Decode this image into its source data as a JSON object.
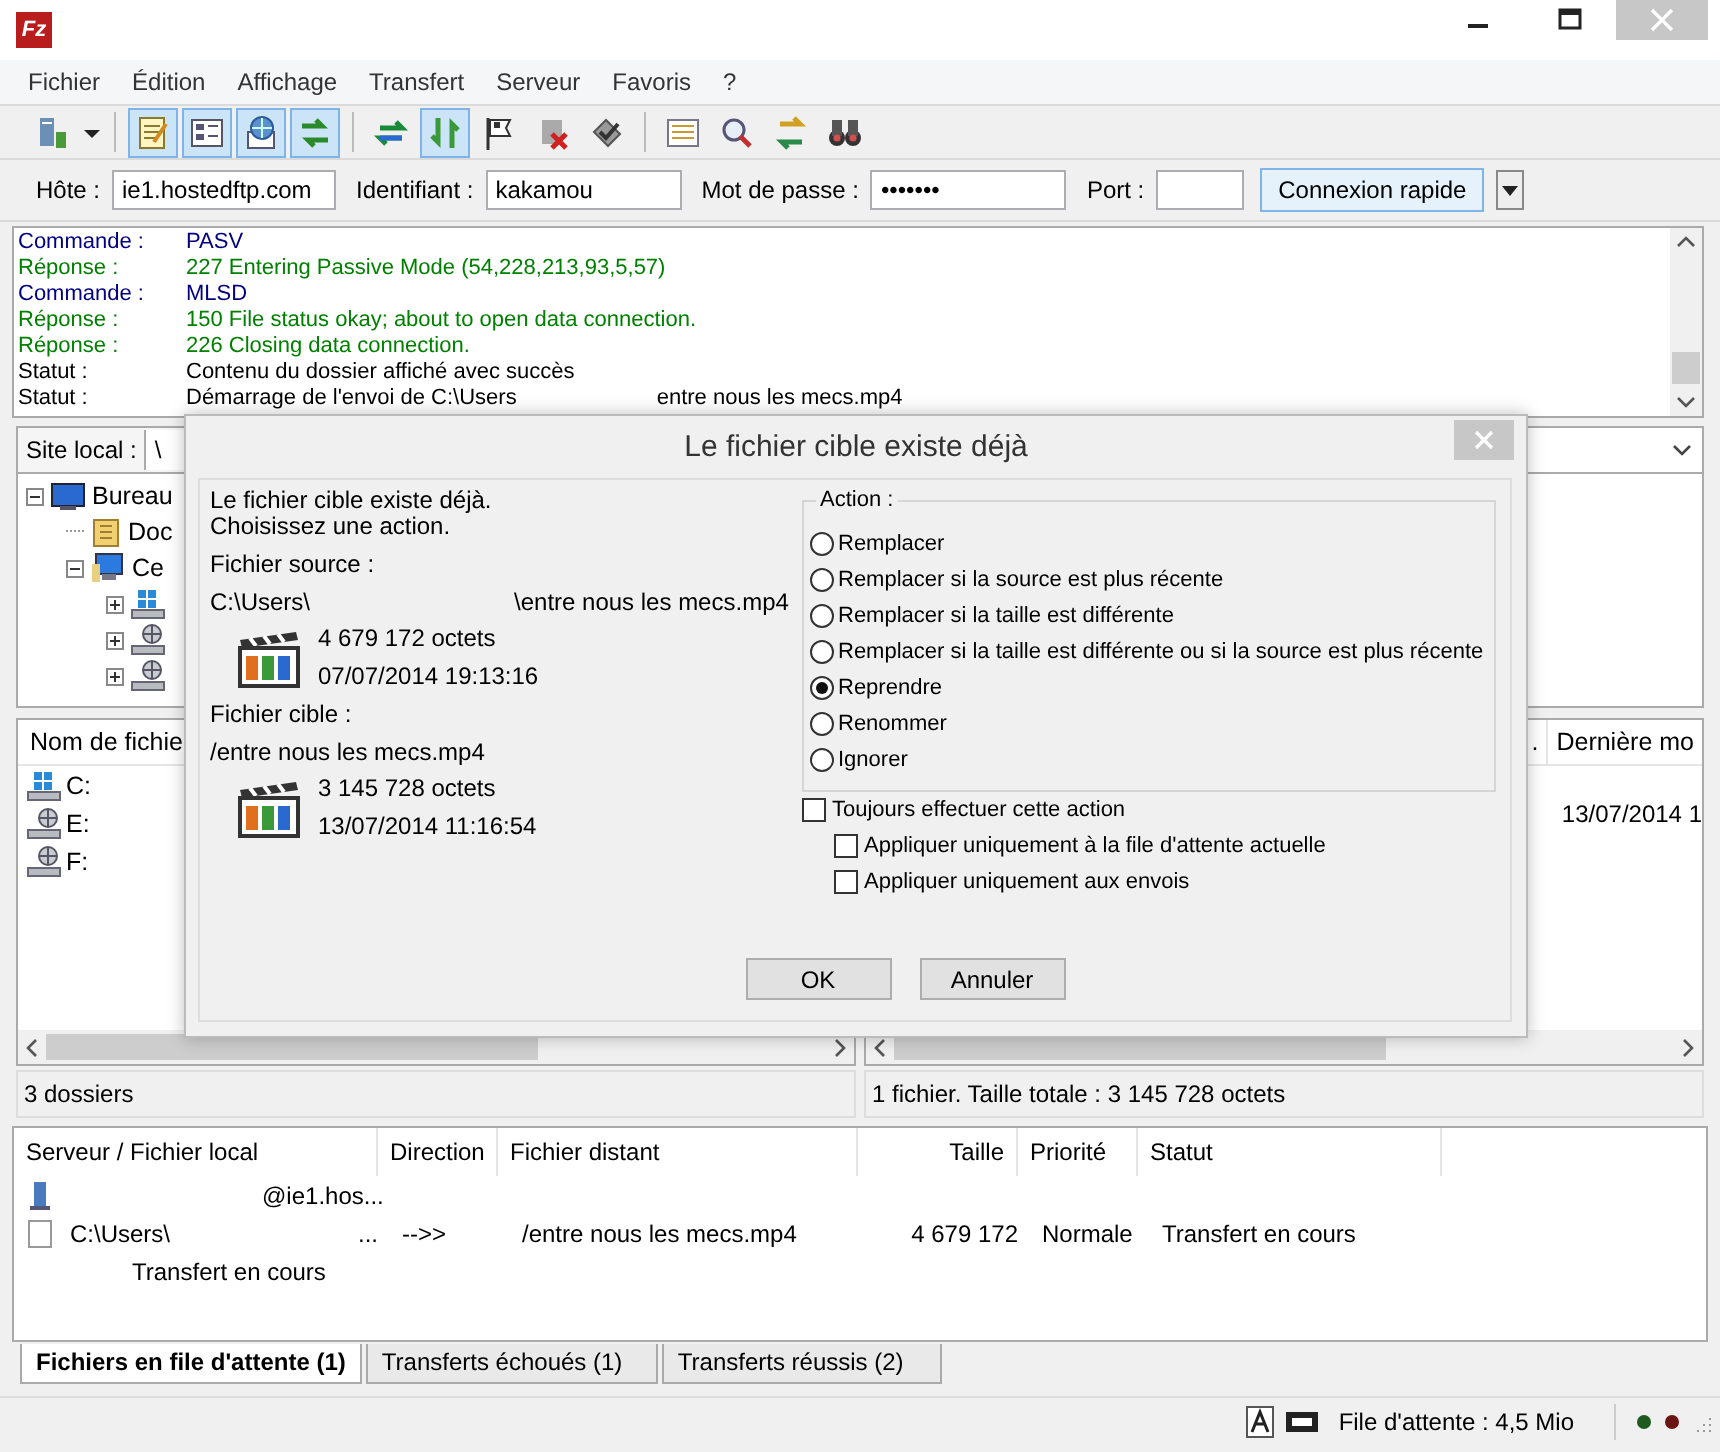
{
  "window": {
    "logo": "Fz"
  },
  "menu": [
    "Fichier",
    "Édition",
    "Affichage",
    "Transfert",
    "Serveur",
    "Favoris",
    "?"
  ],
  "toolbar": [
    {
      "on": false
    },
    {
      "on": true
    },
    {
      "on": true
    },
    {
      "on": true
    },
    {
      "on": true
    },
    {
      "on": false
    },
    {
      "on": true
    },
    {
      "on": false
    },
    {
      "on": false
    },
    {
      "on": false
    },
    {
      "on": false
    },
    {
      "on": false
    },
    {
      "on": false
    },
    {
      "on": false
    }
  ],
  "quickconnect": {
    "host_label": "Hôte :",
    "host": "ie1.hostedftp.com",
    "user_label": "Identifiant :",
    "user": "kakamou",
    "password_label": "Mot de passe :",
    "password": "•••••••",
    "port_label": "Port :",
    "button": "Connexion rapide"
  },
  "log": [
    {
      "kind": "command",
      "label": "Commande :",
      "message": "PASV"
    },
    {
      "kind": "response",
      "label": "Réponse :",
      "message": "227 Entering Passive Mode (54,228,213,93,5,57)"
    },
    {
      "kind": "command",
      "label": "Commande :",
      "message": "MLSD"
    },
    {
      "kind": "response",
      "label": "Réponse :",
      "message": "150 File status okay; about to open data connection."
    },
    {
      "kind": "response",
      "label": "Réponse :",
      "message": "226 Closing data connection."
    },
    {
      "kind": "status",
      "label": "Statut :",
      "message": "Contenu du dossier affiché avec succès"
    },
    {
      "kind": "status",
      "label": "Statut :",
      "message": "Démarrage de l'envoi de C:\\Users",
      "message_tail": "entre nous les mecs.mp4"
    }
  ],
  "local": {
    "label": "Site local :",
    "path": "\\",
    "tree": [
      {
        "kind": "desktop",
        "label": "Bureau",
        "expanded": true,
        "children": [
          {
            "kind": "folder",
            "label": "Doc"
          },
          {
            "kind": "computer",
            "label": "Ce",
            "expanded": true,
            "children": [
              {
                "kind": "drive",
                "expanded": false
              },
              {
                "kind": "network-drive",
                "expanded": false
              },
              {
                "kind": "network-drive",
                "expanded": false
              }
            ]
          }
        ]
      }
    ],
    "columns": [
      "Nom de fichie"
    ],
    "files": [
      {
        "kind": "drive",
        "name": "C:"
      },
      {
        "kind": "network-drive",
        "name": "E:"
      },
      {
        "kind": "network-drive",
        "name": "F:"
      }
    ],
    "status": "3 dossiers"
  },
  "remote": {
    "columns": [
      ".",
      "Dernière mo"
    ],
    "files": [
      {
        "modified": "13/07/2014 1"
      }
    ],
    "status": "1 fichier. Taille totale : 3 145 728 octets"
  },
  "queue": {
    "columns": [
      "Serveur / Fichier local",
      "Direction",
      "Fichier distant",
      "Taille",
      "Priorité",
      "Statut"
    ],
    "rows": [
      {
        "kind": "server",
        "server": "@ie1.hos..."
      },
      {
        "kind": "file",
        "local": "C:\\Users\\",
        "local_tail": "...",
        "direction": "-->>",
        "remote": "/entre nous les mecs.mp4",
        "size": "4 679 172",
        "priority": "Normale",
        "status": "Transfert en cours",
        "progress": "Transfert en cours"
      }
    ]
  },
  "tabs": [
    {
      "label": "Fichiers en file d'attente (1)",
      "selected": true
    },
    {
      "label": "Transferts échoués (1)",
      "selected": false
    },
    {
      "label": "Transferts réussis (2)",
      "selected": false
    }
  ],
  "status_bar": {
    "queue": "File d'attente : 4,5 Mio"
  },
  "dialog": {
    "title": "Le fichier cible existe déjà",
    "intro": [
      "Le fichier cible existe déjà.",
      "Choisissez une action."
    ],
    "source": {
      "label": "Fichier source :",
      "path": "C:\\Users\\",
      "path_tail": "\\entre nous les mecs.mp4",
      "size": "4 679 172 octets",
      "date": "07/07/2014 19:13:16"
    },
    "target": {
      "label": "Fichier cible :",
      "path": "/entre nous les mecs.mp4",
      "size": "3 145 728 octets",
      "date": "13/07/2014 11:16:54"
    },
    "action_label": "Action :",
    "actions": [
      {
        "label": "Remplacer",
        "selected": false
      },
      {
        "label": "Remplacer si la source est plus récente",
        "selected": false
      },
      {
        "label": "Remplacer si la taille est différente",
        "selected": false
      },
      {
        "label": "Remplacer si la taille est différente ou si la source est plus récente",
        "selected": false
      },
      {
        "label": "Reprendre",
        "selected": true
      },
      {
        "label": "Renommer",
        "selected": false
      },
      {
        "label": "Ignorer",
        "selected": false
      }
    ],
    "always": {
      "label": "Toujours effectuer cette action",
      "checked": false,
      "children": [
        {
          "label": "Appliquer uniquement à la file d'attente actuelle",
          "checked": false
        },
        {
          "label": "Appliquer uniquement aux envois",
          "checked": false
        }
      ]
    },
    "buttons": [
      "OK",
      "Annuler"
    ]
  }
}
